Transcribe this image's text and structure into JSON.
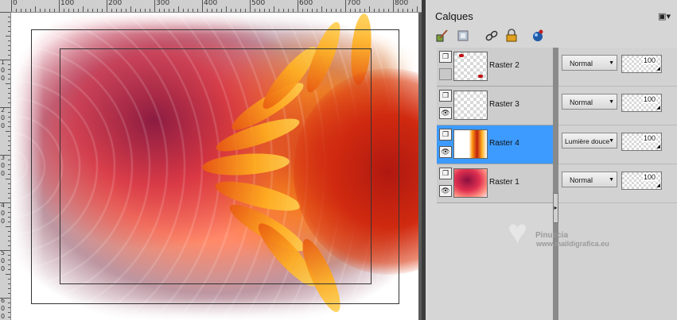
{
  "ruler": {
    "top_labels": [
      "0",
      "100",
      "200",
      "300",
      "400",
      "500",
      "600",
      "700",
      "800"
    ],
    "left_labels": [
      "1",
      "0",
      "0",
      "2",
      "0",
      "0",
      "3",
      "0",
      "0",
      "4",
      "0",
      "0",
      "5",
      "0",
      "0",
      "6",
      "0",
      "0"
    ]
  },
  "panel": {
    "title": "Calques",
    "menu_icon": "panel-menu-icon",
    "toolbar_icons": [
      "edit-brush-icon",
      "mask-icon",
      "link-icon",
      "lock-icon",
      "sphere-icon"
    ]
  },
  "layers": [
    {
      "name": "Raster 2",
      "blend": "Normal",
      "opacity": "100",
      "visible": false,
      "selected": false
    },
    {
      "name": "Raster 3",
      "blend": "Normal",
      "opacity": "100",
      "visible": true,
      "selected": false
    },
    {
      "name": "Raster 4",
      "blend": "Lumière douce",
      "opacity": "100",
      "visible": true,
      "selected": true
    },
    {
      "name": "Raster 1",
      "blend": "Normal",
      "opacity": "100",
      "visible": true,
      "selected": false
    }
  ],
  "watermark": {
    "name": "Pinuccia",
    "url": "www.maildigrafica.eu"
  },
  "colors": {
    "selected_row": "#3d9bff",
    "panel_bg": "#d6d6d6"
  }
}
